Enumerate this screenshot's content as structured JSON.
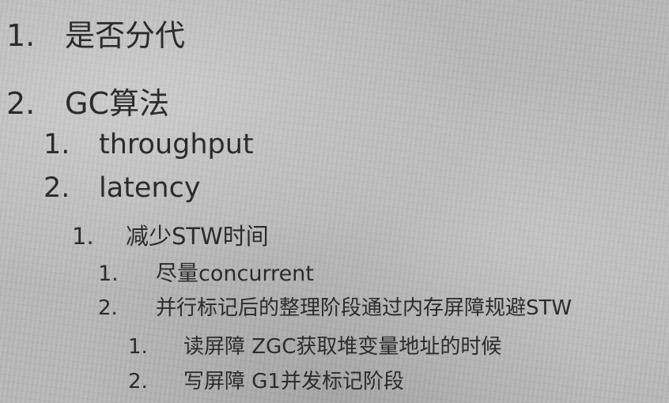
{
  "outline": [
    {
      "num": "1.",
      "text": "是否分代"
    },
    {
      "num": "2.",
      "text": "GC算法"
    },
    {
      "num": "1.",
      "text": "throughput"
    },
    {
      "num": "2.",
      "text": "latency"
    },
    {
      "num": "1.",
      "text": "减少STW时间"
    },
    {
      "num": "1.",
      "text": "尽量concurrent"
    },
    {
      "num": "2.",
      "text": "并行标记后的整理阶段通过内存屏障规避STW"
    },
    {
      "num": "1.",
      "text": "读屏障 ZGC获取堆变量地址的时候"
    },
    {
      "num": "2.",
      "text": "写屏障 G1并发标记阶段"
    }
  ]
}
